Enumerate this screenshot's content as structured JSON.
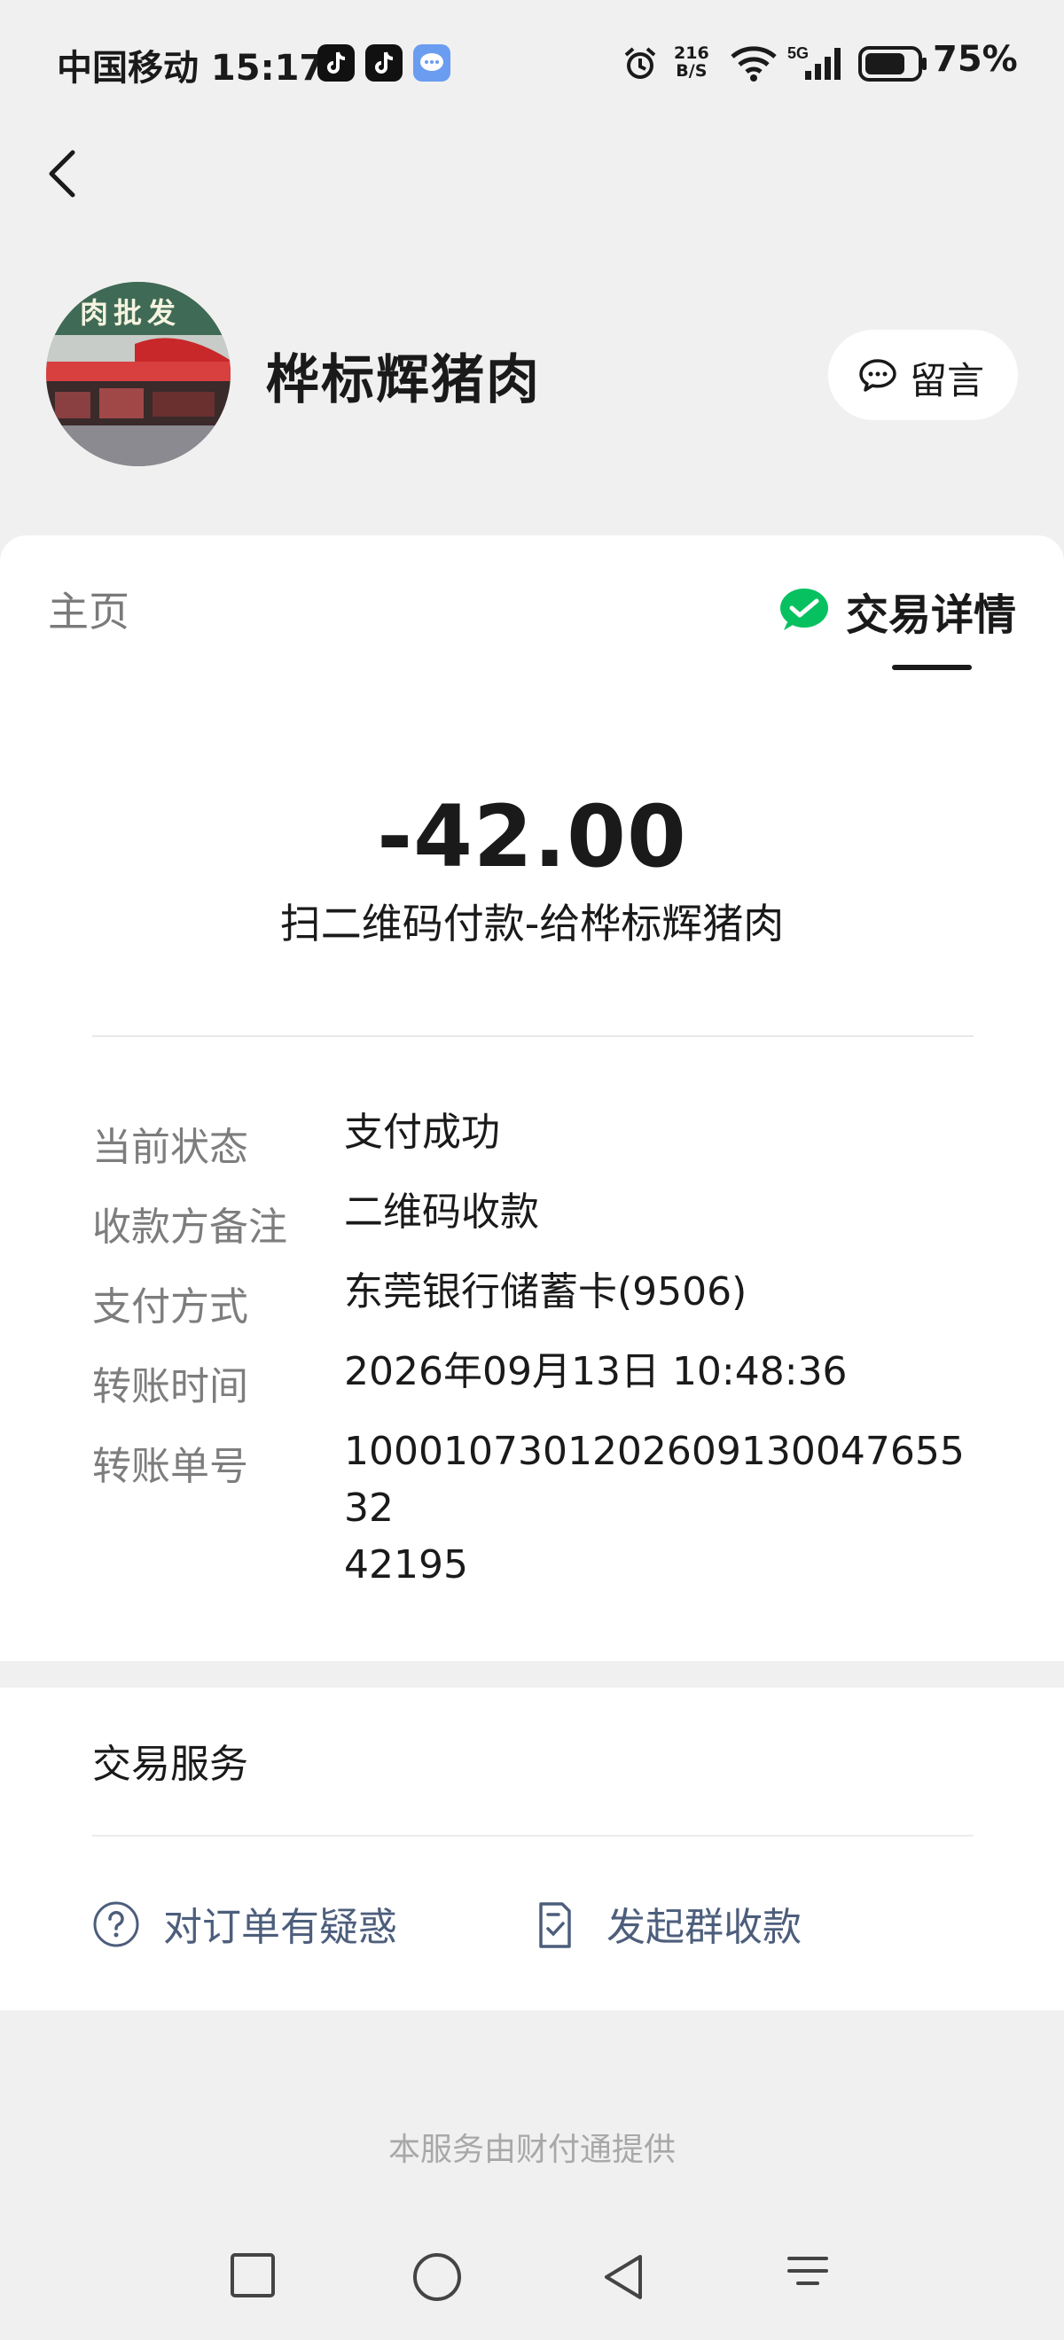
{
  "status_bar": {
    "carrier_time": "中国移动 15:17",
    "net_speed_value": "216",
    "net_speed_unit": "B/S",
    "battery": "75%"
  },
  "header": {
    "merchant_name": "桦标辉猪肉",
    "avatar_sign_text": "肉批发",
    "message_label": "留言"
  },
  "tabs": {
    "home": "主页",
    "detail": "交易详情"
  },
  "transaction": {
    "amount": "-42.00",
    "description": "扫二维码付款-给桦标辉猪肉",
    "rows": [
      {
        "label": "当前状态",
        "value": "支付成功"
      },
      {
        "label": "收款方备注",
        "value": "二维码收款"
      },
      {
        "label": "支付方式",
        "value": "东莞银行储蓄卡(9506)"
      },
      {
        "label": "转账时间",
        "value": "2026年09月13日 10:48:36"
      },
      {
        "label": "转账单号",
        "value": "100010730120260913004765532\n42195"
      }
    ]
  },
  "services": {
    "title": "交易服务",
    "doubt_label": "对订单有疑惑",
    "group_collect_label": "发起群收款"
  },
  "footer": "本服务由财付通提供",
  "colors": {
    "background": "#f0f0f0",
    "wechat_green": "#07c160",
    "link_blue_gray": "#4d5e7c"
  }
}
